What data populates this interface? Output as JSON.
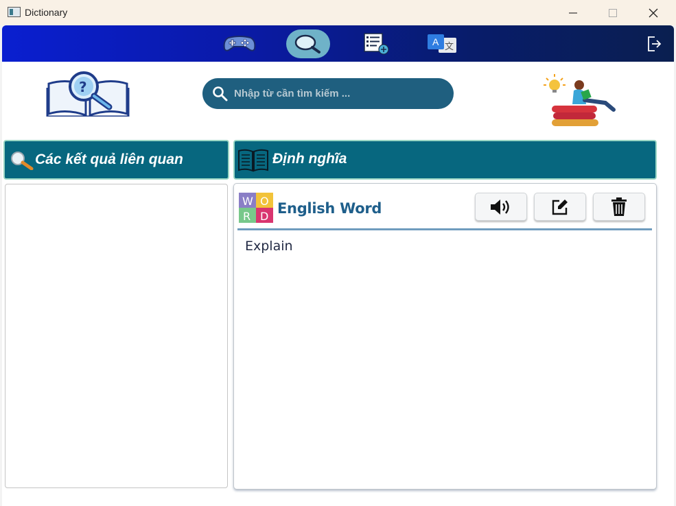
{
  "window": {
    "title": "Dictionary",
    "app_icon": "app-window-icon",
    "controls": [
      "minimize-icon",
      "maximize-icon",
      "close-icon"
    ]
  },
  "navbar": {
    "items": [
      {
        "name": "game",
        "icon": "gamepad-icon",
        "active": false
      },
      {
        "name": "search",
        "icon": "magnifier-icon",
        "active": true
      },
      {
        "name": "word-list",
        "icon": "list-add-icon",
        "active": false
      },
      {
        "name": "translate",
        "icon": "translate-icon",
        "active": false
      }
    ],
    "logout_icon": "logout-icon",
    "colors": {
      "gradient_start": "#0a1fd0",
      "gradient_end": "#0a1f50",
      "active_pill": "#6fb2c8"
    }
  },
  "search": {
    "placeholder": "Nhập từ cần tìm kiếm ...",
    "value": "",
    "color": "#1f5f7f"
  },
  "related": {
    "header": "Các kết quả liên quan",
    "header_icon": "magnifier-icon",
    "items": []
  },
  "definition": {
    "header": "Định nghĩa",
    "header_icon": "open-book-icon",
    "word_icon": "word-puzzle-icon",
    "word": "English Word",
    "explain": "Explain",
    "buttons": [
      {
        "name": "speak",
        "icon": "speaker-icon"
      },
      {
        "name": "edit",
        "icon": "edit-icon"
      },
      {
        "name": "delete",
        "icon": "trash-icon"
      }
    ]
  },
  "colors": {
    "header_bg": "#07677f",
    "header_border": "#9ad6c4",
    "word_color": "#1f5f8b"
  }
}
